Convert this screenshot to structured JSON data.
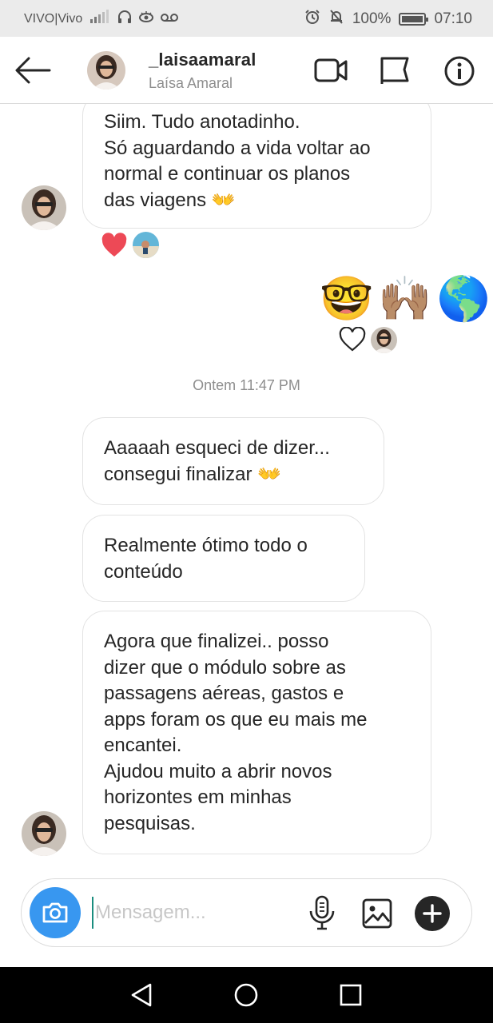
{
  "status_bar": {
    "carrier": "VIVO|Vivo",
    "battery": "100%",
    "time": "07:10"
  },
  "header": {
    "username": "_laisaamaral",
    "full_name": "Laísa Amaral"
  },
  "messages": [
    {
      "from": "them",
      "lines": [
        "Siim. Tudo anotadinho.",
        "Só aguardando a vida voltar ao",
        "normal e continuar os planos",
        "das viagens 👐"
      ],
      "reaction": "heart"
    },
    {
      "from": "me",
      "emojis": [
        "🤓",
        "🙌🏽",
        "🌎"
      ],
      "reaction": "heart-outline"
    },
    {
      "from": "them",
      "lines": [
        "Aaaaah esqueci de dizer...",
        "consegui finalizar 👐"
      ]
    },
    {
      "from": "them",
      "lines": [
        "Realmente ótimo todo o",
        "conteúdo"
      ]
    },
    {
      "from": "them",
      "lines": [
        "Agora que finalizei.. posso",
        "dizer que o módulo sobre as",
        "passagens aéreas, gastos e",
        "apps foram os que eu mais me",
        "encantei.",
        "Ajudou muito a abrir novos",
        "horizontes em minhas",
        "pesquisas."
      ]
    }
  ],
  "timestamp": "Ontem 11:47 PM",
  "composer": {
    "placeholder": "Mensagem..."
  },
  "colors": {
    "accent": "#3897f0",
    "heart": "#ed4956",
    "bubble_border": "#e3e3e3",
    "secondary_text": "#8e8e8e"
  },
  "icons": [
    "arrow-left-icon",
    "video-camera-icon",
    "flag-icon",
    "info-icon",
    "heart-icon",
    "camera-icon",
    "microphone-icon",
    "image-icon",
    "plus-icon",
    "nav-back-icon",
    "nav-home-icon",
    "nav-recents-icon"
  ]
}
